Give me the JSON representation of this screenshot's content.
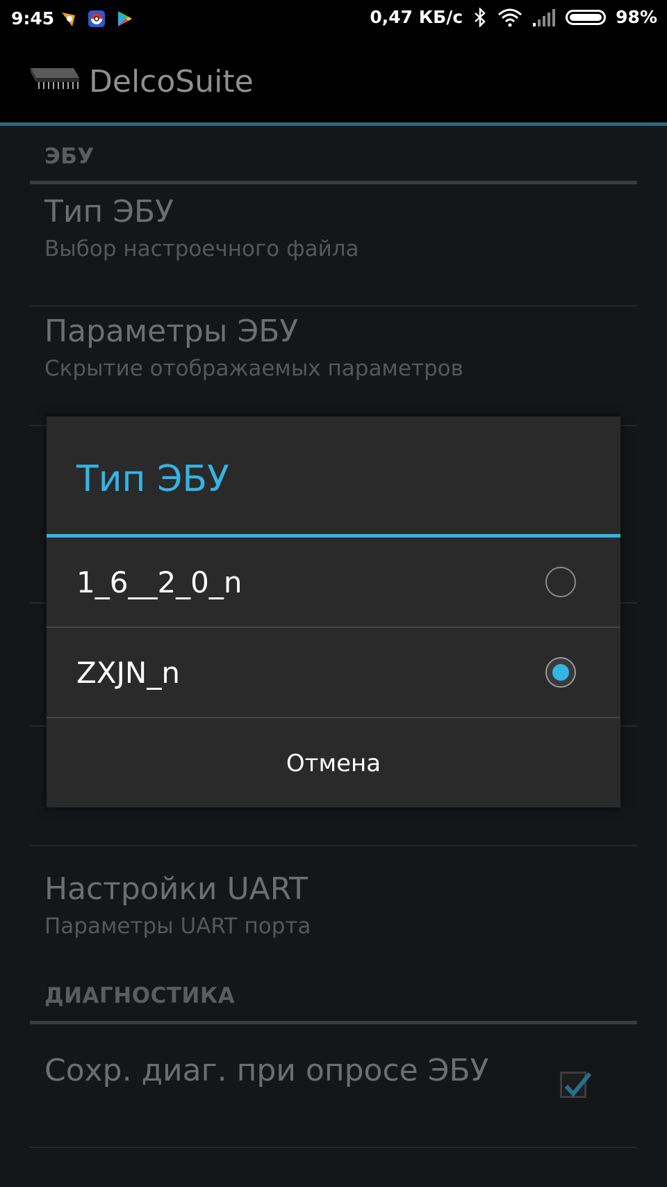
{
  "status_bar": {
    "time": "9:45",
    "speed": "0,47 КБ/с",
    "battery": "98%",
    "icons": [
      "notification-app-icon",
      "pokeball-app-icon",
      "play-store-icon",
      "bluetooth-icon",
      "wifi-icon",
      "signal-icon",
      "battery-icon"
    ]
  },
  "action_bar": {
    "title": "DelcoSuite",
    "icon": "chip-icon"
  },
  "settings": {
    "category_ecu": "ЭБУ",
    "ecu_type_title": "Тип ЭБУ",
    "ecu_type_summary": "Выбор настроечного файла",
    "ecu_params_title": "Параметры ЭБУ",
    "ecu_params_summary": "Скрытие отображаемых параметров",
    "uart_title": "Настройки UART",
    "uart_summary": "Параметры UART порта",
    "category_diag": "ДИАГНОСТИКА",
    "save_diag_title": "Сохр. диаг. при опросе ЭБУ",
    "save_diag_checked": true
  },
  "dialog": {
    "title": "Тип ЭБУ",
    "options": [
      {
        "label": "1_6__2_0_n",
        "selected": false
      },
      {
        "label": "ZXJN_n",
        "selected": true
      }
    ],
    "cancel_label": "Отмена"
  },
  "colors": {
    "accent": "#33b5e5",
    "actionbar_divider": "#2b6a82",
    "background": "#141618",
    "dialog_bg": "#2a2a2a"
  }
}
